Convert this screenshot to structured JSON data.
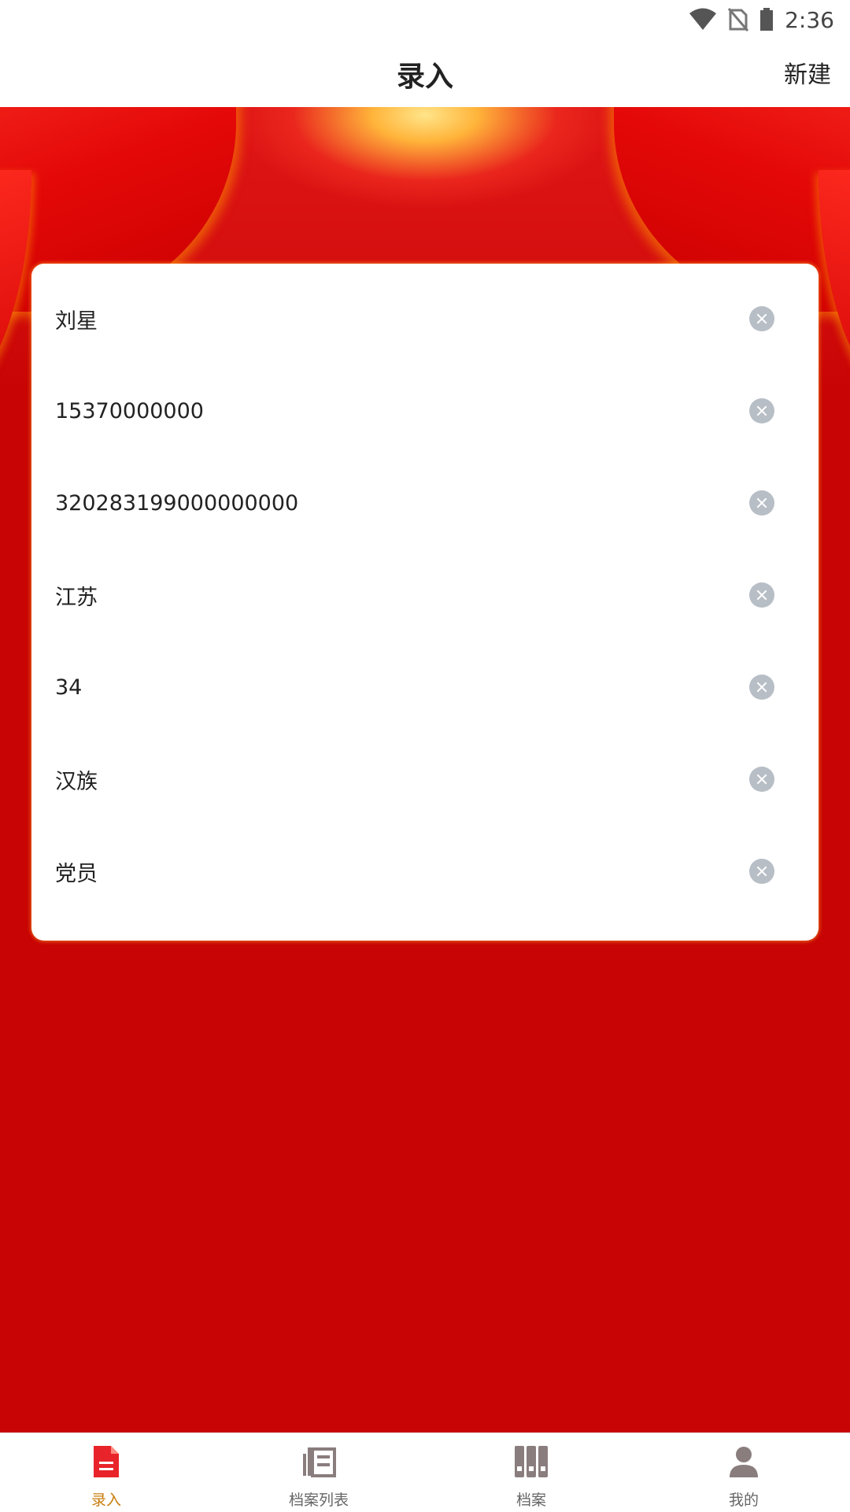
{
  "status_bar": {
    "time": "2:36",
    "icons": [
      "wifi-icon",
      "no-sim-icon",
      "battery-icon"
    ]
  },
  "header": {
    "title": "录入",
    "new_label": "新建"
  },
  "form": {
    "fields": [
      {
        "value": "刘星"
      },
      {
        "value": "15370000000"
      },
      {
        "value": "320283199000000000"
      },
      {
        "value": "江苏"
      },
      {
        "value": "34"
      },
      {
        "value": "汉族"
      },
      {
        "value": "党员"
      }
    ]
  },
  "nav": {
    "items": [
      {
        "label": "录入",
        "icon": "document-entry-icon",
        "active": true
      },
      {
        "label": "档案列表",
        "icon": "newspaper-list-icon",
        "active": false
      },
      {
        "label": "档案",
        "icon": "archive-binders-icon",
        "active": false
      },
      {
        "label": "我的",
        "icon": "person-icon",
        "active": false
      }
    ]
  },
  "colors": {
    "background_red": "#c80404",
    "active_nav": "#c87c0c",
    "inactive_nav_icon": "#8a7d7d",
    "clear_icon": "#b8bec6"
  }
}
